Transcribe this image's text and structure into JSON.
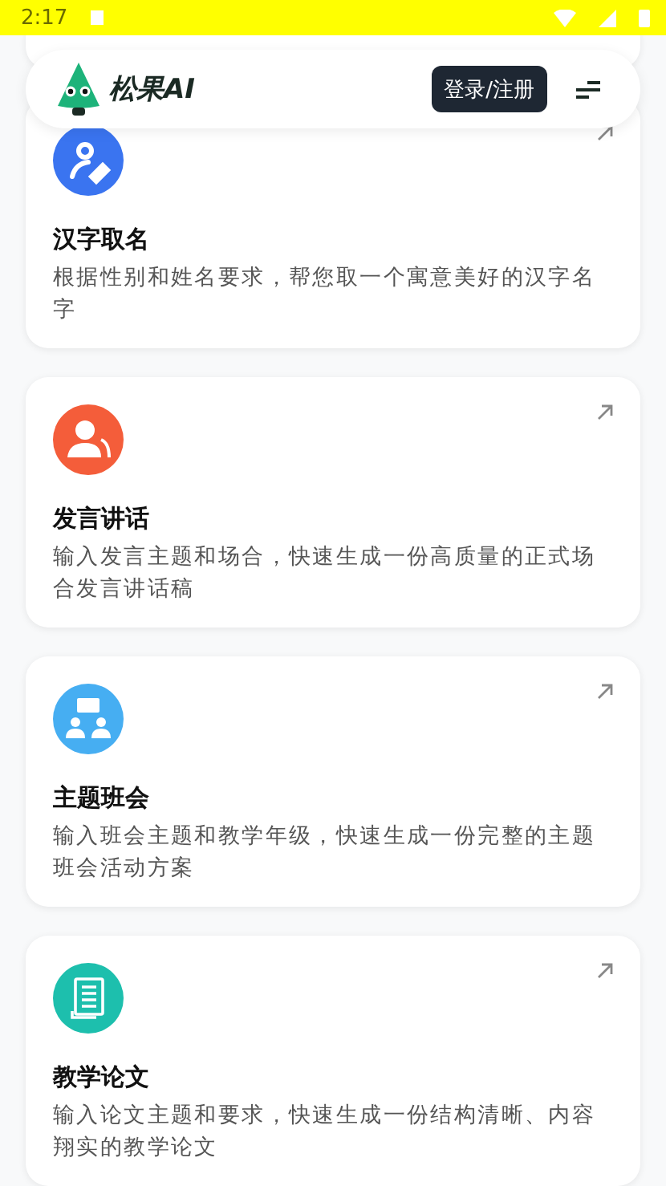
{
  "status_bar": {
    "time": "2:17"
  },
  "header": {
    "brand": "松果AI",
    "login_button": "登录/注册"
  },
  "cards": [
    {
      "kind": "naming",
      "color": "#3a74f0",
      "title": "汉字取名",
      "description": "根据性别和姓名要求，帮您取一个寓意美好的汉字名字"
    },
    {
      "kind": "speech",
      "color": "#f45d3a",
      "title": "发言讲话",
      "description": "输入发言主题和场合，快速生成一份高质量的正式场合发言讲话稿"
    },
    {
      "kind": "meeting",
      "color": "#46aef2",
      "title": "主题班会",
      "description": "输入班会主题和教学年级，快速生成一份完整的主题班会活动方案"
    },
    {
      "kind": "thesis",
      "color": "#1dbfad",
      "title": "教学论文",
      "description": "输入论文主题和要求，快速生成一份结构清晰、内容翔实的教学论文"
    }
  ]
}
